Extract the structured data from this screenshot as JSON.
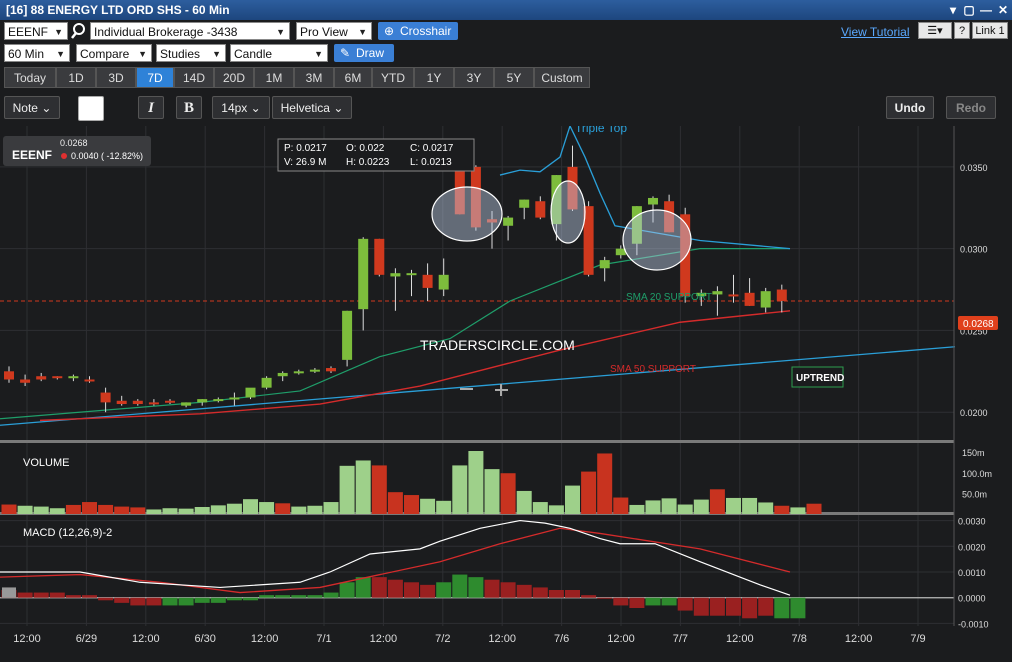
{
  "window": {
    "title": "[16] 88 ENERGY LTD ORD SHS - 60 Min",
    "controls": [
      "▾",
      "▢",
      "—",
      "☐",
      "✕"
    ]
  },
  "toolbar1": {
    "symbol": "EEENF",
    "account": "Individual Brokerage -3438",
    "view": "Pro View",
    "crosshair_label": "Crosshair",
    "tutorial_link": "View Tutorial",
    "help_label": "?",
    "link_label": "Link 1"
  },
  "toolbar2": {
    "interval": "60 Min",
    "compare": "Compare",
    "studies": "Studies",
    "chart_type": "Candle",
    "draw_label": "Draw"
  },
  "ranges": {
    "items": [
      "Today",
      "1D",
      "3D",
      "7D",
      "14D",
      "20D",
      "1M",
      "3M",
      "6M",
      "YTD",
      "1Y",
      "3Y",
      "5Y",
      "Custom"
    ],
    "active": "7D"
  },
  "draw_tools": {
    "note": "Note",
    "italic": "I",
    "bold": "B",
    "size": "14px",
    "font": "Helvetica",
    "undo": "Undo",
    "redo": "Redo"
  },
  "quote": {
    "symbol": "EEENF",
    "last": "0.0268",
    "change": "0.0040 ( -12.82%)",
    "change_color": "#e03030"
  },
  "ohlc": {
    "p": "P: 0.0217",
    "o": "O: 0.022",
    "c": "C: 0.0217",
    "v": "V: 26.9 M",
    "h": "H: 0.0223",
    "l": "L: 0.0213"
  },
  "annotations": {
    "triple_top": "Triple Top",
    "watermark": "TRADERSCIRCLE.COM",
    "sma20": "SMA 20 SUPPORT",
    "sma50": "SMA 50 SUPPORT",
    "uptrend": "UPTREND",
    "price_tag": "0.0268"
  },
  "colors": {
    "up": "#7dbd3c",
    "down": "#d0391e",
    "sma20": "#1f9e6a",
    "sma50": "#d42b2b",
    "trend": "#2a9fd8",
    "volume_up": "#9ed08a",
    "volume_down": "#c8331f",
    "macd_line": "#ffffff",
    "signal_line": "#d42b2b",
    "hist_up": "#2e8b2e",
    "hist_down": "#9a2020"
  },
  "chart_data": [
    {
      "type": "candlestick",
      "title": "",
      "x_labels": [
        "12:00",
        "6/29",
        "12:00",
        "6/30",
        "12:00",
        "7/1",
        "12:00",
        "7/2",
        "12:00",
        "7/6",
        "12:00",
        "7/7",
        "12:00",
        "7/8",
        "12:00",
        "7/9"
      ],
      "y_ticks": [
        "0.0350",
        "0.0300",
        "0.0250",
        "0.0200"
      ],
      "ylim": [
        0.0183,
        0.0375
      ],
      "candles": [
        [
          0.0225,
          0.0228,
          0.0218,
          0.022
        ],
        [
          0.022,
          0.0223,
          0.0216,
          0.0218
        ],
        [
          0.0222,
          0.0224,
          0.0219,
          0.022
        ],
        [
          0.0222,
          0.0222,
          0.022,
          0.0221
        ],
        [
          0.0221,
          0.0223,
          0.0219,
          0.0222
        ],
        [
          0.022,
          0.0222,
          0.0218,
          0.0219
        ],
        [
          0.0212,
          0.0215,
          0.02,
          0.0206
        ],
        [
          0.0207,
          0.021,
          0.0204,
          0.0205
        ],
        [
          0.0207,
          0.0208,
          0.0204,
          0.0205
        ],
        [
          0.0206,
          0.0208,
          0.0204,
          0.0205
        ],
        [
          0.0207,
          0.0208,
          0.0205,
          0.0206
        ],
        [
          0.0204,
          0.0206,
          0.0203,
          0.0206
        ],
        [
          0.0206,
          0.0208,
          0.0204,
          0.0208
        ],
        [
          0.0207,
          0.0209,
          0.0206,
          0.0208
        ],
        [
          0.0208,
          0.0212,
          0.0204,
          0.0209
        ],
        [
          0.0209,
          0.0212,
          0.0208,
          0.0215
        ],
        [
          0.0215,
          0.0222,
          0.0214,
          0.0221
        ],
        [
          0.0222,
          0.0225,
          0.0219,
          0.0224
        ],
        [
          0.0224,
          0.0226,
          0.0223,
          0.0225
        ],
        [
          0.0225,
          0.0227,
          0.0224,
          0.0226
        ],
        [
          0.0227,
          0.0228,
          0.0224,
          0.0225
        ],
        [
          0.0232,
          0.0262,
          0.0228,
          0.0262
        ],
        [
          0.0263,
          0.0307,
          0.025,
          0.0306
        ],
        [
          0.0306,
          0.0306,
          0.0283,
          0.0284
        ],
        [
          0.0283,
          0.0288,
          0.0262,
          0.0285
        ],
        [
          0.0284,
          0.0287,
          0.0271,
          0.0285
        ],
        [
          0.0284,
          0.0291,
          0.0268,
          0.0276
        ],
        [
          0.0275,
          0.0294,
          0.0271,
          0.0284
        ],
        [
          0.0351,
          0.0358,
          0.0321,
          0.0321
        ],
        [
          0.035,
          0.0351,
          0.0311,
          0.0313
        ],
        [
          0.0318,
          0.0323,
          0.03,
          0.0316
        ],
        [
          0.0314,
          0.032,
          0.0305,
          0.0319
        ],
        [
          0.0325,
          0.033,
          0.0318,
          0.033
        ],
        [
          0.0329,
          0.0332,
          0.0318,
          0.0319
        ],
        [
          0.0315,
          0.0345,
          0.0305,
          0.0345
        ],
        [
          0.035,
          0.0363,
          0.0323,
          0.0324
        ],
        [
          0.0326,
          0.0329,
          0.0283,
          0.0284
        ],
        [
          0.0288,
          0.0295,
          0.028,
          0.0293
        ],
        [
          0.0296,
          0.0302,
          0.0294,
          0.03
        ],
        [
          0.0303,
          0.0326,
          0.0296,
          0.0326
        ],
        [
          0.0327,
          0.0332,
          0.0316,
          0.0331
        ],
        [
          0.0329,
          0.0333,
          0.031,
          0.031
        ],
        [
          0.0321,
          0.0325,
          0.0267,
          0.0271
        ],
        [
          0.0271,
          0.0275,
          0.0265,
          0.0273
        ],
        [
          0.0272,
          0.0277,
          0.0259,
          0.0274
        ],
        [
          0.0272,
          0.0284,
          0.0267,
          0.0271
        ],
        [
          0.0273,
          0.0282,
          0.0265,
          0.0265
        ],
        [
          0.0264,
          0.0276,
          0.0261,
          0.0274
        ],
        [
          0.0275,
          0.0278,
          0.0261,
          0.0268
        ]
      ],
      "price_line": 0.0268,
      "sma20": [
        [
          0,
          0.0196
        ],
        [
          200,
          0.0206
        ],
        [
          300,
          0.0213
        ],
        [
          380,
          0.0234
        ],
        [
          450,
          0.0245
        ],
        [
          510,
          0.0268
        ],
        [
          600,
          0.029
        ],
        [
          700,
          0.03
        ],
        [
          790,
          0.03
        ]
      ],
      "sma50": [
        [
          40,
          0.0195
        ],
        [
          200,
          0.0199
        ],
        [
          320,
          0.0205
        ],
        [
          420,
          0.0216
        ],
        [
          560,
          0.0238
        ],
        [
          680,
          0.0255
        ],
        [
          790,
          0.0262
        ]
      ],
      "trend_line": [
        [
          0,
          0.0192
        ],
        [
          955,
          0.024
        ]
      ],
      "triple_top_line": [
        [
          500,
          0.0345
        ],
        [
          520,
          0.0348
        ],
        [
          540,
          0.0347
        ],
        [
          560,
          0.0356
        ],
        [
          570,
          0.0375
        ],
        [
          585,
          0.0356
        ],
        [
          600,
          0.0334
        ],
        [
          615,
          0.0314
        ],
        [
          700,
          0.0305
        ],
        [
          790,
          0.03
        ]
      ]
    },
    {
      "type": "bar",
      "title": "VOLUME",
      "y_ticks": [
        "150m",
        "100.0m",
        "50.0m"
      ],
      "ylim": [
        0,
        170
      ],
      "values": [
        [
          23,
          "d"
        ],
        [
          20,
          "u"
        ],
        [
          18,
          "u"
        ],
        [
          14,
          "u"
        ],
        [
          22,
          "d"
        ],
        [
          29,
          "d"
        ],
        [
          22,
          "d"
        ],
        [
          18,
          "d"
        ],
        [
          16,
          "d"
        ],
        [
          11,
          "u"
        ],
        [
          14,
          "u"
        ],
        [
          13,
          "u"
        ],
        [
          17,
          "u"
        ],
        [
          21,
          "u"
        ],
        [
          25,
          "u"
        ],
        [
          36,
          "u"
        ],
        [
          29,
          "u"
        ],
        [
          26,
          "d"
        ],
        [
          18,
          "u"
        ],
        [
          20,
          "u"
        ],
        [
          29,
          "u"
        ],
        [
          117,
          "u"
        ],
        [
          130,
          "u"
        ],
        [
          118,
          "d"
        ],
        [
          53,
          "d"
        ],
        [
          46,
          "d"
        ],
        [
          37,
          "u"
        ],
        [
          32,
          "u"
        ],
        [
          118,
          "u"
        ],
        [
          153,
          "u"
        ],
        [
          109,
          "u"
        ],
        [
          99,
          "d"
        ],
        [
          56,
          "u"
        ],
        [
          29,
          "u"
        ],
        [
          21,
          "u"
        ],
        [
          69,
          "u"
        ],
        [
          103,
          "d"
        ],
        [
          147,
          "d"
        ],
        [
          40,
          "d"
        ],
        [
          22,
          "u"
        ],
        [
          33,
          "u"
        ],
        [
          38,
          "u"
        ],
        [
          23,
          "u"
        ],
        [
          35,
          "u"
        ],
        [
          60,
          "d"
        ],
        [
          39,
          "u"
        ],
        [
          39,
          "u"
        ],
        [
          28,
          "u"
        ],
        [
          20,
          "d"
        ],
        [
          16,
          "u"
        ],
        [
          25,
          "d"
        ]
      ]
    },
    {
      "type": "line",
      "title": "MACD (12,26,9)-2",
      "y_ticks": [
        "0.0030",
        "0.0020",
        "0.0010",
        "0.0000",
        "-0.0010"
      ],
      "ylim": [
        -0.0011,
        0.0031
      ],
      "macd": [
        [
          0,
          0.001
        ],
        [
          80,
          0.001
        ],
        [
          140,
          0.0006
        ],
        [
          220,
          0.0004
        ],
        [
          300,
          0.0006
        ],
        [
          330,
          0.001
        ],
        [
          370,
          0.0017
        ],
        [
          420,
          0.0019
        ],
        [
          440,
          0.0022
        ],
        [
          480,
          0.0027
        ],
        [
          520,
          0.003
        ],
        [
          545,
          0.0029
        ],
        [
          570,
          0.0027
        ],
        [
          600,
          0.0023
        ],
        [
          620,
          0.0021
        ],
        [
          655,
          0.0021
        ],
        [
          700,
          0.0014
        ],
        [
          760,
          0.0005
        ],
        [
          790,
          0.0001
        ]
      ],
      "signal": [
        [
          0,
          0.0008
        ],
        [
          80,
          0.0009
        ],
        [
          160,
          0.0006
        ],
        [
          240,
          0.0002
        ],
        [
          320,
          0.0004
        ],
        [
          380,
          0.0009
        ],
        [
          440,
          0.0014
        ],
        [
          500,
          0.0021
        ],
        [
          560,
          0.0027
        ],
        [
          600,
          0.0025
        ],
        [
          700,
          0.0019
        ],
        [
          790,
          0.001
        ]
      ],
      "histogram": [
        [
          0.0003,
          "d"
        ],
        [
          0.0002,
          "d"
        ],
        [
          0.0002,
          "d"
        ],
        [
          0.0002,
          "d"
        ],
        [
          0.0001,
          "d"
        ],
        [
          0.0001,
          "d"
        ],
        [
          -0.0001,
          "d"
        ],
        [
          -0.0002,
          "d"
        ],
        [
          -0.0003,
          "d"
        ],
        [
          -0.0003,
          "d"
        ],
        [
          -0.0003,
          "u"
        ],
        [
          -0.0003,
          "u"
        ],
        [
          -0.0002,
          "u"
        ],
        [
          -0.0002,
          "u"
        ],
        [
          -0.0001,
          "u"
        ],
        [
          -0.0001,
          "u"
        ],
        [
          0.0001,
          "u"
        ],
        [
          0.0001,
          "u"
        ],
        [
          0.0001,
          "u"
        ],
        [
          0.0001,
          "u"
        ],
        [
          0.0002,
          "u"
        ],
        [
          0.0006,
          "u"
        ],
        [
          0.0008,
          "u"
        ],
        [
          0.0008,
          "d"
        ],
        [
          0.0007,
          "d"
        ],
        [
          0.0006,
          "d"
        ],
        [
          0.0005,
          "d"
        ],
        [
          0.0006,
          "u"
        ],
        [
          0.0009,
          "u"
        ],
        [
          0.0008,
          "u"
        ],
        [
          0.0007,
          "d"
        ],
        [
          0.0006,
          "d"
        ],
        [
          0.0005,
          "d"
        ],
        [
          0.0004,
          "d"
        ],
        [
          0.0003,
          "d"
        ],
        [
          0.0003,
          "d"
        ],
        [
          0.0001,
          "d"
        ],
        [
          0.0,
          "d"
        ],
        [
          -0.0003,
          "d"
        ],
        [
          -0.0004,
          "d"
        ],
        [
          -0.0003,
          "u"
        ],
        [
          -0.0003,
          "u"
        ],
        [
          -0.0005,
          "d"
        ],
        [
          -0.0007,
          "d"
        ],
        [
          -0.0007,
          "d"
        ],
        [
          -0.0007,
          "d"
        ],
        [
          -0.0008,
          "d"
        ],
        [
          -0.0007,
          "d"
        ],
        [
          -0.0008,
          "u"
        ],
        [
          -0.0008,
          "u"
        ]
      ]
    }
  ]
}
